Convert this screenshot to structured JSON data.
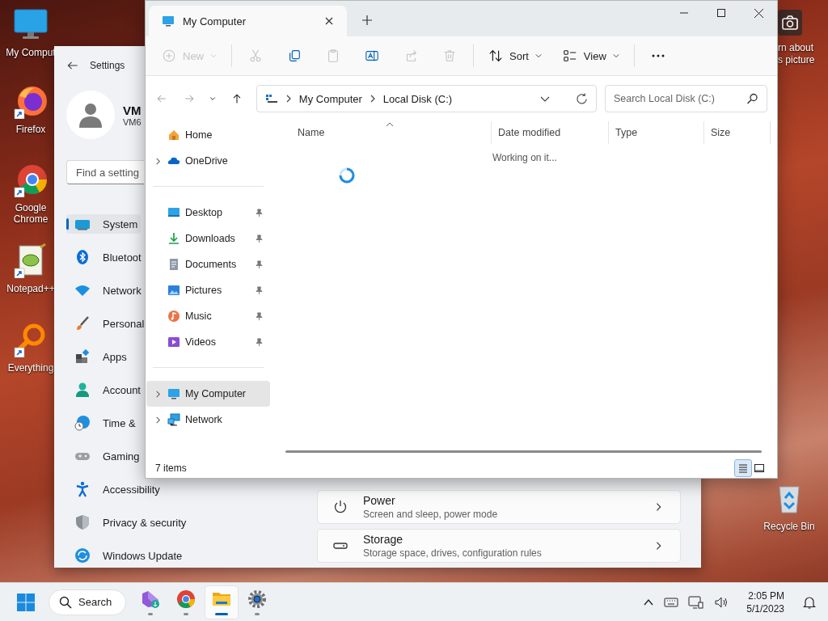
{
  "desktop": {
    "icons": [
      {
        "kind": "computer",
        "label": "My Comput",
        "shortcut": false
      },
      {
        "kind": "firefox",
        "label": "Firefox",
        "shortcut": true
      },
      {
        "kind": "chrome",
        "label": "Google Chrome",
        "shortcut": true
      },
      {
        "kind": "notepad",
        "label": "Notepad++",
        "shortcut": true
      },
      {
        "kind": "everything",
        "label": "Everything",
        "shortcut": true
      }
    ],
    "picture_info": {
      "lines": [
        "rn about",
        "s picture"
      ]
    },
    "recycle_bin": {
      "label": "Recycle Bin"
    }
  },
  "settings": {
    "title": "Settings",
    "user": {
      "name": "VM",
      "account": "VM6"
    },
    "search": {
      "placeholder": "Find a setting"
    },
    "nav": [
      {
        "kind": "system",
        "label": "System",
        "selected": true
      },
      {
        "kind": "bluetooth",
        "label": "Bluetoot",
        "selected": false
      },
      {
        "kind": "network",
        "label": "Network",
        "selected": false
      },
      {
        "kind": "personalization",
        "label": "Personal",
        "selected": false
      },
      {
        "kind": "apps",
        "label": "Apps",
        "selected": false
      },
      {
        "kind": "accounts",
        "label": "Account",
        "selected": false
      },
      {
        "kind": "time",
        "label": "Time &",
        "selected": false
      },
      {
        "kind": "gaming",
        "label": "Gaming",
        "selected": false
      },
      {
        "kind": "accessibility",
        "label": "Accessibility",
        "selected": false
      },
      {
        "kind": "privacy",
        "label": "Privacy & security",
        "selected": false
      },
      {
        "kind": "update",
        "label": "Windows Update",
        "selected": false
      }
    ],
    "cards": [
      {
        "kind": "power",
        "title": "Power",
        "subtitle": "Screen and sleep, power mode"
      },
      {
        "kind": "storage",
        "title": "Storage",
        "subtitle": "Storage space, drives, configuration rules"
      }
    ]
  },
  "explorer": {
    "tabs": [
      {
        "title": "My Computer",
        "selected": true
      }
    ],
    "toolbar": [
      {
        "kind": "new",
        "label": "New",
        "disabled": true
      },
      {
        "kind": "cut",
        "disabled": true
      },
      {
        "kind": "copy",
        "disabled": false
      },
      {
        "kind": "paste",
        "disabled": true
      },
      {
        "kind": "rename",
        "disabled": false
      },
      {
        "kind": "share",
        "disabled": true
      },
      {
        "kind": "delete",
        "disabled": true
      },
      {
        "kind": "sort",
        "label": "Sort",
        "disabled": false
      },
      {
        "kind": "view",
        "label": "View",
        "disabled": false
      },
      {
        "kind": "more",
        "disabled": false
      }
    ],
    "nav_buttons": [
      {
        "kind": "back",
        "disabled": true
      },
      {
        "kind": "forward",
        "disabled": true
      },
      {
        "kind": "recent",
        "disabled": false
      },
      {
        "kind": "up",
        "disabled": false
      }
    ],
    "address": {
      "crumbs": [
        "My Computer",
        "Local Disk (C:)"
      ]
    },
    "search": {
      "placeholder": "Search Local Disk (C:)"
    },
    "sidebar": {
      "groups": [
        [
          {
            "kind": "home",
            "label": "Home",
            "expandable": false,
            "pinned": false,
            "selected": false
          },
          {
            "kind": "onedrive",
            "label": "OneDrive",
            "expandable": true,
            "pinned": false,
            "selected": false
          }
        ],
        [
          {
            "kind": "desktop",
            "label": "Desktop",
            "expandable": false,
            "pinned": true,
            "selected": false
          },
          {
            "kind": "downloads",
            "label": "Downloads",
            "expandable": false,
            "pinned": true,
            "selected": false
          },
          {
            "kind": "documents",
            "label": "Documents",
            "expandable": false,
            "pinned": true,
            "selected": false
          },
          {
            "kind": "pictures",
            "label": "Pictures",
            "expandable": false,
            "pinned": true,
            "selected": false
          },
          {
            "kind": "music",
            "label": "Music",
            "expandable": false,
            "pinned": true,
            "selected": false
          },
          {
            "kind": "videos",
            "label": "Videos",
            "expandable": false,
            "pinned": true,
            "selected": false
          }
        ],
        [
          {
            "kind": "computer",
            "label": "My Computer",
            "expandable": true,
            "pinned": false,
            "selected": true
          },
          {
            "kind": "network",
            "label": "Network",
            "expandable": true,
            "pinned": false,
            "selected": false
          }
        ]
      ]
    },
    "columns": [
      {
        "label": "Name",
        "sorted": true
      },
      {
        "label": "Date modified",
        "sorted": false
      },
      {
        "label": "Type",
        "sorted": false
      },
      {
        "label": "Size",
        "sorted": false
      }
    ],
    "loading_text": "Working on it...",
    "status_bar": {
      "count": "7 items",
      "views": [
        {
          "kind": "details",
          "selected": true
        },
        {
          "kind": "tiles",
          "selected": false
        }
      ]
    }
  },
  "taskbar": {
    "search": {
      "label": "Search"
    },
    "apps": [
      {
        "kind": "editor",
        "active": false
      },
      {
        "kind": "chrome",
        "active": false
      },
      {
        "kind": "explorer",
        "active": true
      },
      {
        "kind": "settings",
        "active": false
      }
    ],
    "time": "2:05 PM",
    "date": "5/1/2023"
  }
}
